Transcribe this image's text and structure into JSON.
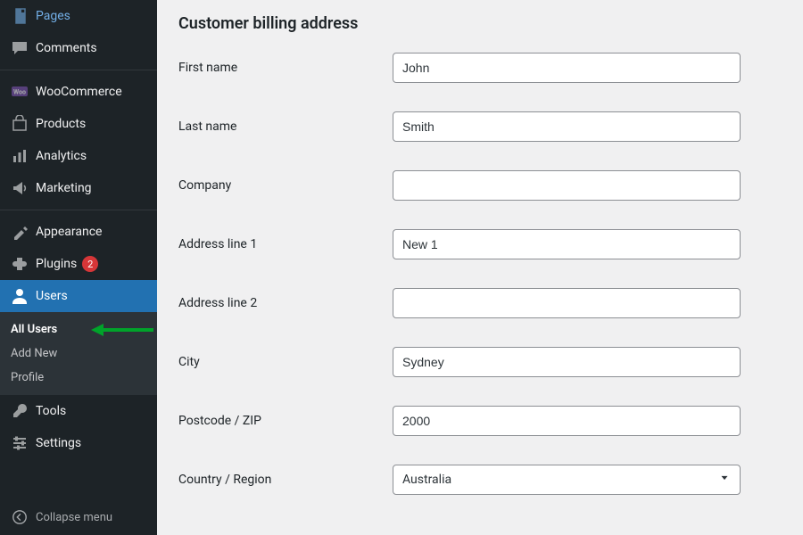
{
  "sidebar": {
    "items": [
      {
        "label": "Pages"
      },
      {
        "label": "Comments"
      },
      {
        "label": "WooCommerce"
      },
      {
        "label": "Products"
      },
      {
        "label": "Analytics"
      },
      {
        "label": "Marketing"
      },
      {
        "label": "Appearance"
      },
      {
        "label": "Plugins",
        "badge": "2"
      },
      {
        "label": "Users"
      },
      {
        "label": "Tools"
      },
      {
        "label": "Settings"
      }
    ],
    "submenu": [
      {
        "label": "All Users"
      },
      {
        "label": "Add New"
      },
      {
        "label": "Profile"
      }
    ],
    "collapse": "Collapse menu"
  },
  "form": {
    "title": "Customer billing address",
    "fields": {
      "first_name": {
        "label": "First name",
        "value": "John"
      },
      "last_name": {
        "label": "Last name",
        "value": "Smith"
      },
      "company": {
        "label": "Company",
        "value": ""
      },
      "address1": {
        "label": "Address line 1",
        "value": "New 1"
      },
      "address2": {
        "label": "Address line 2",
        "value": ""
      },
      "city": {
        "label": "City",
        "value": "Sydney"
      },
      "postcode": {
        "label": "Postcode / ZIP",
        "value": "2000"
      },
      "country": {
        "label": "Country / Region",
        "value": "Australia"
      }
    }
  }
}
